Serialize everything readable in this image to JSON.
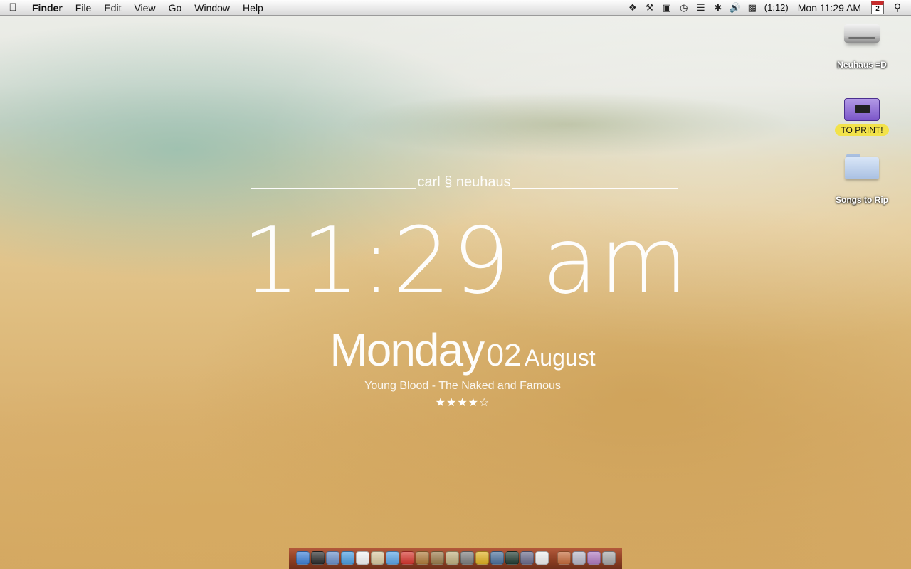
{
  "menubar": {
    "apple_icon": "apple-icon",
    "items": [
      "Finder",
      "File",
      "Edit",
      "View",
      "Go",
      "Window",
      "Help"
    ],
    "status": {
      "battery_time": "(1:12)",
      "clock": "Mon 11:29 AM",
      "calendar_day": "2"
    }
  },
  "desktop": {
    "icons": [
      {
        "label": "Neuhaus =D",
        "icon": "hard-drive-icon"
      },
      {
        "label": "TO PRINT!",
        "icon": "printer-icon"
      },
      {
        "label": "Songs to Rip",
        "icon": "folder-icon"
      }
    ]
  },
  "widget": {
    "name": "carl § neuhaus",
    "time": "11:29 am",
    "day": "Monday",
    "date": "02",
    "month": "August",
    "now_playing": "Young Blood - The Naked and Famous",
    "rating_stars": "★★★★☆",
    "rating": 4
  },
  "dock": {
    "apps": [
      {
        "icon": "finder-icon",
        "color": "#3d7fd6"
      },
      {
        "icon": "dashboard-icon",
        "color": "#2a2a2a"
      },
      {
        "icon": "mail-icon",
        "color": "#6b8fc9"
      },
      {
        "icon": "safari-icon",
        "color": "#4a9de0"
      },
      {
        "icon": "ical-icon",
        "color": "#f4f4f4"
      },
      {
        "icon": "preview-icon",
        "color": "#d9c9a0"
      },
      {
        "icon": "itunes-icon",
        "color": "#5aa4e6"
      },
      {
        "icon": "lastfm-icon",
        "color": "#d6342c"
      },
      {
        "icon": "photo-icon",
        "color": "#b07a3a"
      },
      {
        "icon": "utility-icon",
        "color": "#9a7a4a"
      },
      {
        "icon": "app-icon",
        "color": "#c0b080"
      },
      {
        "icon": "screenshot-icon",
        "color": "#7d7d7d"
      },
      {
        "icon": "chrome-icon",
        "color": "#e0b020"
      },
      {
        "icon": "network-icon",
        "color": "#4a6f9a"
      },
      {
        "icon": "activity-monitor-icon",
        "color": "#203a30"
      },
      {
        "icon": "script-editor-icon",
        "color": "#6a6a8a"
      },
      {
        "icon": "textedit-icon",
        "color": "#efefef"
      }
    ],
    "stacks": [
      {
        "icon": "stack-icon",
        "color": "#c56a3a"
      },
      {
        "icon": "documents-stack-icon",
        "color": "#b8b8c8"
      },
      {
        "icon": "downloads-stack-icon",
        "color": "#b07ac0"
      },
      {
        "icon": "trash-icon",
        "color": "#a8a8a8"
      }
    ]
  }
}
